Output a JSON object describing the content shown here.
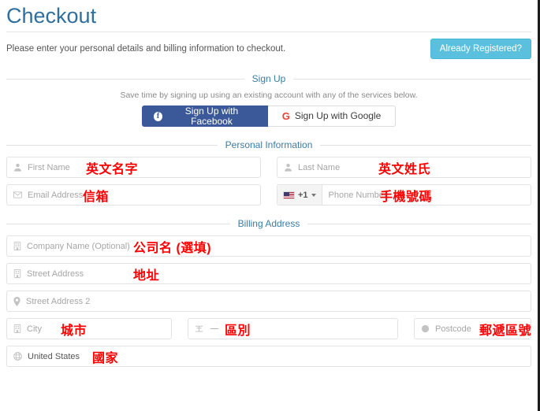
{
  "header": {
    "title": "Checkout",
    "subtitle": "Please enter your personal details and billing information to checkout.",
    "already_registered_label": "Already Registered?",
    "already_registered_color": "#5bc0de"
  },
  "signup_section": {
    "divider_label": "Sign Up",
    "note": "Save time by signing up using an existing account with any of the services below.",
    "facebook_button": {
      "label": "Sign Up with Facebook",
      "glyph": "f",
      "color": "#3b5998"
    },
    "google_button": {
      "label": "Sign Up with Google",
      "glyph": "G",
      "color": "#ffffff"
    }
  },
  "personal_section": {
    "divider_label": "Personal Information",
    "fields": {
      "first_name": {
        "icon": "user-icon",
        "placeholder": "First Name",
        "annotation": "英文名字"
      },
      "last_name": {
        "icon": "user-icon",
        "placeholder": "Last Name",
        "annotation": "英文姓氏"
      },
      "email": {
        "icon": "envelope-icon",
        "placeholder": "Email Address",
        "annotation": "信箱"
      },
      "phone": {
        "icon": "flag-us-icon",
        "country_code": "+1",
        "placeholder": "Phone Number",
        "annotation": "手機號碼"
      }
    }
  },
  "billing_section": {
    "divider_label": "Billing Address",
    "fields": {
      "company": {
        "icon": "building-icon",
        "placeholder": "Company Name (Optional)",
        "annotation": "公司名 (選填)"
      },
      "street_address": {
        "icon": "building-icon",
        "placeholder": "Street Address",
        "annotation": "地址"
      },
      "street_address_2": {
        "icon": "map-pin-icon",
        "placeholder": "Street Address 2",
        "annotation": ""
      },
      "city": {
        "icon": "building-icon",
        "placeholder": "City",
        "annotation": "城市"
      },
      "state": {
        "icon": "region-icon",
        "placeholder": "",
        "annotation": "區別"
      },
      "postcode": {
        "icon": "circle-icon",
        "placeholder": "Postcode",
        "annotation": "郵遞區號"
      },
      "country": {
        "icon": "globe-icon",
        "value": "United States",
        "annotation": "國家"
      }
    }
  },
  "annotation_color": "#ff0000"
}
